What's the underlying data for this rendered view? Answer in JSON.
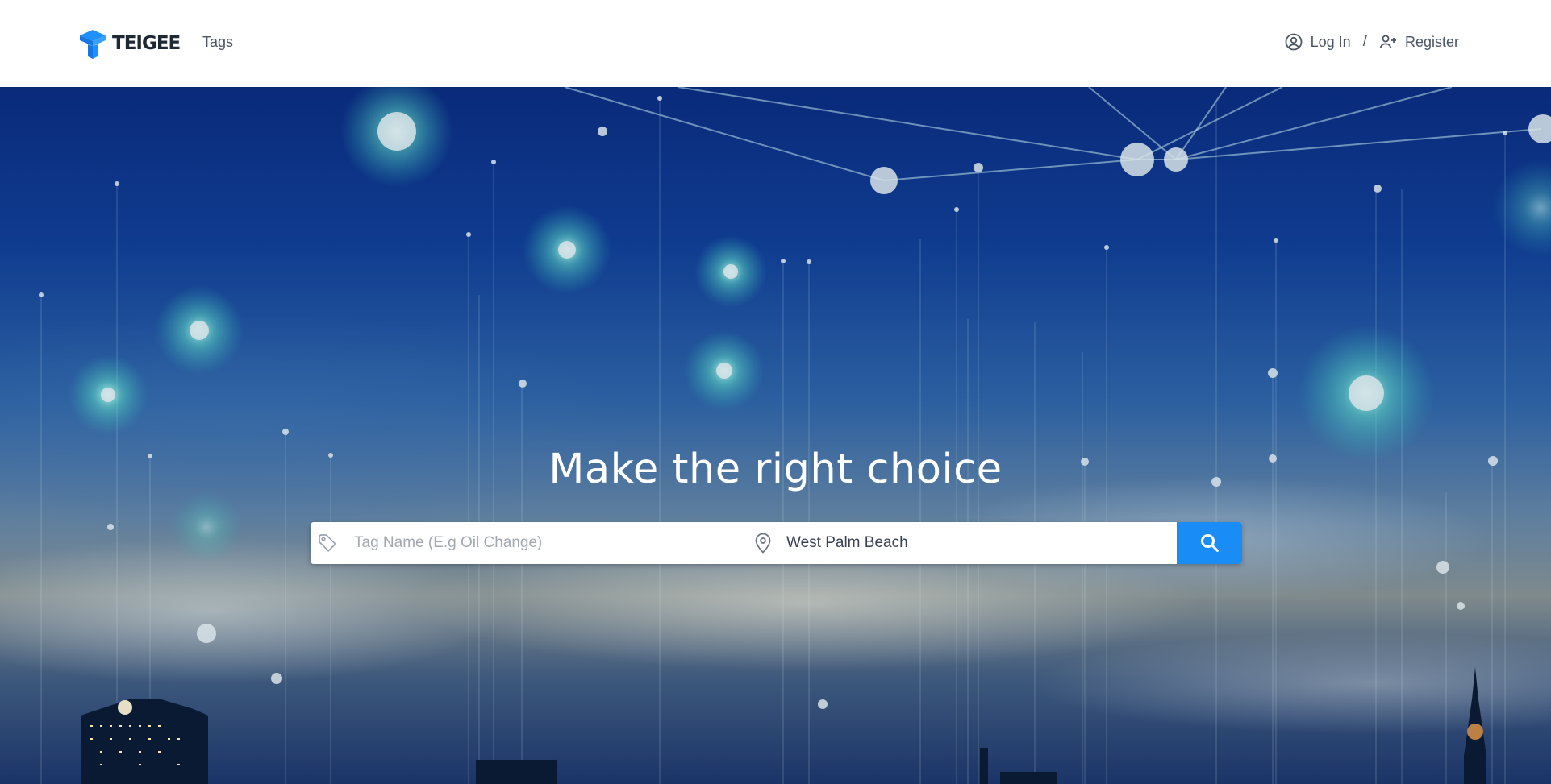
{
  "header": {
    "brand": "TEIGEE",
    "nav": {
      "tags": "Tags"
    },
    "auth": {
      "login": "Log In",
      "separator": "/",
      "register": "Register"
    }
  },
  "hero": {
    "title": "Make the right choice",
    "search": {
      "tag_placeholder": "Tag Name (E.g Oil Change)",
      "location_value": "West Palm Beach"
    }
  },
  "colors": {
    "accent": "#1a8cf5",
    "logo": "#1e90ff"
  },
  "icons": [
    "logo-icon",
    "user-circle-icon",
    "user-plus-icon",
    "tag-icon",
    "location-pin-icon",
    "search-icon"
  ]
}
